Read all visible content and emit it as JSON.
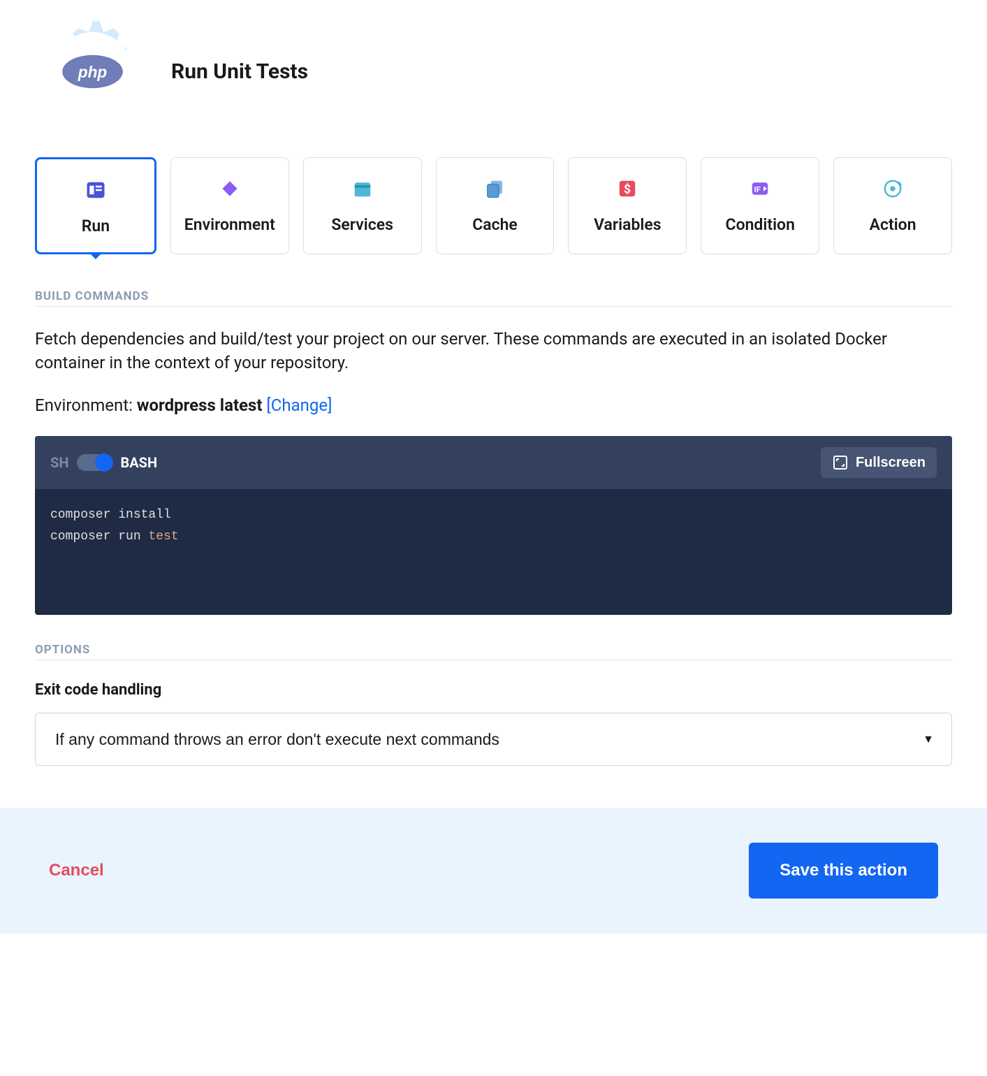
{
  "header": {
    "title": "Run Unit Tests",
    "badge_text": "php"
  },
  "tabs": [
    {
      "label": "Run",
      "active": true
    },
    {
      "label": "Environment",
      "active": false
    },
    {
      "label": "Services",
      "active": false
    },
    {
      "label": "Cache",
      "active": false
    },
    {
      "label": "Variables",
      "active": false
    },
    {
      "label": "Condition",
      "active": false
    },
    {
      "label": "Action",
      "active": false
    }
  ],
  "build_commands": {
    "section_label": "BUILD COMMANDS",
    "description": "Fetch dependencies and build/test your project on our server. These commands are executed in an isolated Docker container in the context of your repository.",
    "env_label": "Environment: ",
    "env_value": "wordpress latest",
    "change_link": "[Change]"
  },
  "code": {
    "sh_label": "SH",
    "bash_label": "BASH",
    "fullscreen": "Fullscreen",
    "lines": [
      {
        "plain": "composer install"
      },
      {
        "plain": "composer run ",
        "keyword": "test"
      }
    ]
  },
  "options": {
    "section_label": "OPTIONS",
    "exit_code_title": "Exit code handling",
    "exit_code_value": "If any command throws an error don't execute next commands"
  },
  "footer": {
    "cancel": "Cancel",
    "save": "Save this action"
  },
  "colors": {
    "primary": "#1266F1",
    "danger": "#e74c5e",
    "code_bg": "#1f2a44"
  }
}
